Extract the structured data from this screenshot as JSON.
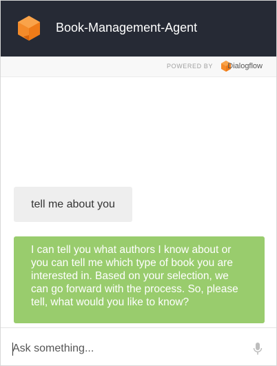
{
  "header": {
    "title": "Book-Management-Agent",
    "logo_icon": "dialogflow-cube-icon",
    "background": "#262a35"
  },
  "powered_by": {
    "label": "POWERED BY",
    "brand_name": "Dialogflow",
    "brand_icon": "dialogflow-logo-icon"
  },
  "chat": {
    "messages": [
      {
        "sender": "user",
        "text": "tell me about you"
      },
      {
        "sender": "agent",
        "text": "I can tell you what authors I know about or you can tell me which type of book you are interested in. Based on your selection, we can go forward with the process. So, please tell, what would you like to know?"
      }
    ]
  },
  "input": {
    "placeholder": "Ask something...",
    "value": "",
    "mic_icon": "microphone-icon"
  },
  "colors": {
    "brand_orange": "#f48b2a",
    "agent_bubble": "#99cc6d",
    "user_bubble": "#eeeeee"
  }
}
